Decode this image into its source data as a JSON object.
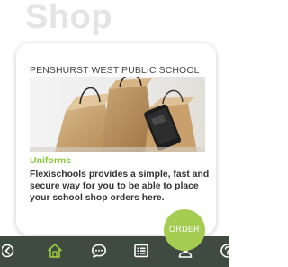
{
  "page": {
    "title": "Shop"
  },
  "card": {
    "school_name": "PENSHURST WEST PUBLIC SCHOOL",
    "image": "shopping-bags-with-phone",
    "category": "Uniforms",
    "description": "Flexischools provides a simple, fast and secure way for you to be able to place your school shop orders here.",
    "order_label": "ORDER"
  },
  "nav": {
    "items": [
      {
        "icon": "chevron-left-icon"
      },
      {
        "icon": "home-icon",
        "active": true
      },
      {
        "icon": "chat-icon"
      },
      {
        "icon": "list-icon"
      },
      {
        "icon": "user-icon"
      },
      {
        "icon": "help-icon"
      }
    ]
  },
  "colors": {
    "accent": "#8dc63f",
    "order_button": "#a5cd52",
    "nav_background": "#3f4a40",
    "nav_icon": "#ffffff",
    "nav_icon_active": "#9ccc3c",
    "title_text": "#e4e4e4"
  }
}
